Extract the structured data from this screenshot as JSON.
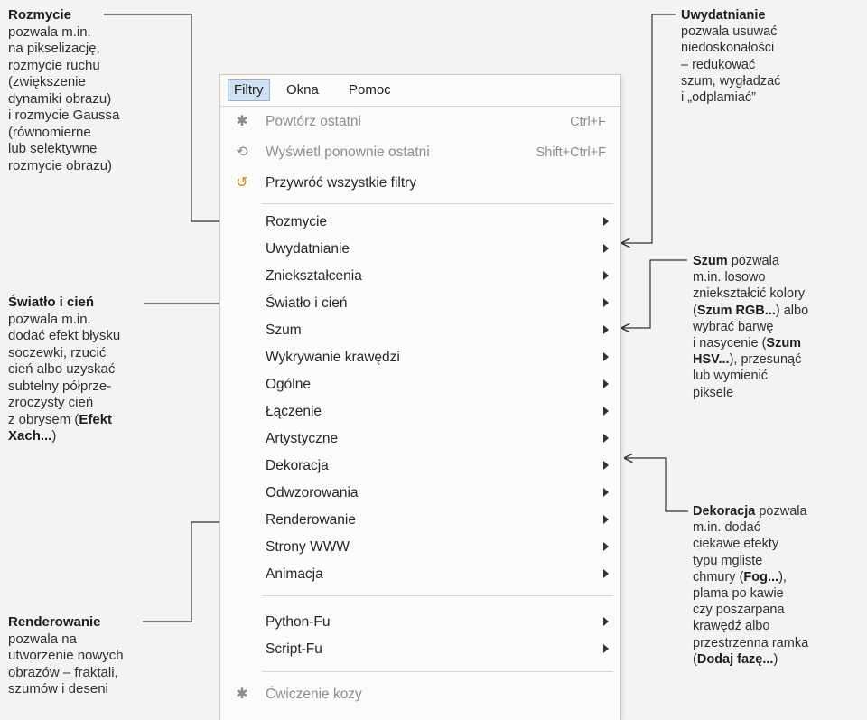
{
  "menubar": {
    "items": [
      {
        "label": "Filtry",
        "active": true
      },
      {
        "label": "Okna",
        "active": false
      },
      {
        "label": "Pomoc",
        "active": false
      }
    ]
  },
  "menu": {
    "top_items": [
      {
        "icon": "repeat-icon",
        "label": "Powtórz ostatni",
        "shortcut": "Ctrl+F",
        "disabled": true
      },
      {
        "icon": "reshow-icon",
        "label": "Wyświetl ponownie ostatni",
        "shortcut": "Shift+Ctrl+F",
        "disabled": true
      },
      {
        "icon": "reset-icon",
        "label": "Przywróć wszystkie filtry",
        "shortcut": "",
        "disabled": false
      }
    ],
    "submenus": [
      "Rozmycie",
      "Uwydatnianie",
      "Zniekształcenia",
      "Światło i cień",
      "Szum",
      "Wykrywanie krawędzi",
      "Ogólne",
      "Łączenie",
      "Artystyczne",
      "Dekoracja",
      "Odwzorowania",
      "Renderowanie",
      "Strony WWW",
      "Animacja"
    ],
    "scripts": [
      "Python-Fu",
      "Script-Fu"
    ],
    "bottom_item": {
      "icon": "goat-icon",
      "label": "Ćwiczenie kozy",
      "disabled": true
    }
  },
  "annotations": {
    "rozmycie": {
      "title": "Rozmycie",
      "lines": [
        "pozwala m.in.",
        "na pikselizację,",
        "rozmycie ruchu",
        "(zwiększenie",
        "dynamiki obrazu)",
        "i rozmycie Gaussa",
        "(równomierne",
        "lub selektywne",
        "rozmycie obrazu)"
      ]
    },
    "swiatlo": {
      "title": "Światło i cień",
      "lines": [
        "pozwala m.in.",
        "dodać efekt błysku",
        "soczewki, rzucić",
        "cień albo uzyskać",
        "subtelny półprze-",
        "zroczysty cień",
        "z obrysem (",
        "Efekt",
        "Xach...",
        ")"
      ]
    },
    "renderowanie": {
      "title": "Renderowanie",
      "lines": [
        "pozwala na",
        "utworzenie nowych",
        "obrazów – fraktali,",
        "szumów i deseni"
      ]
    },
    "uwydatnianie": {
      "title": "Uwydatnianie",
      "lines": [
        "pozwala usuwać",
        "niedoskonałości",
        "– redukować",
        "szum, wygładzać",
        "i „odplamiać”"
      ]
    },
    "szum": {
      "title": "Szum",
      "lines": [
        " pozwala",
        "m.in. losowo",
        "zniekształcić kolory",
        "(",
        "Szum RGB...",
        ") albo",
        "wybrać barwę",
        "i nasycenie (",
        "Szum",
        "HSV...",
        "), przesunąć",
        "lub wymienić",
        "piksele"
      ]
    },
    "dekoracja": {
      "title": "Dekoracja",
      "lines": [
        " pozwala",
        "m.in. dodać",
        "ciekawe efekty",
        "typu mgliste",
        "chmury (",
        "Fog...",
        "),",
        "plama po kawie",
        "czy poszarpana",
        "krawędź albo",
        "przestrzenna ramka",
        "(",
        "Dodaj fazę...",
        ")"
      ]
    }
  }
}
